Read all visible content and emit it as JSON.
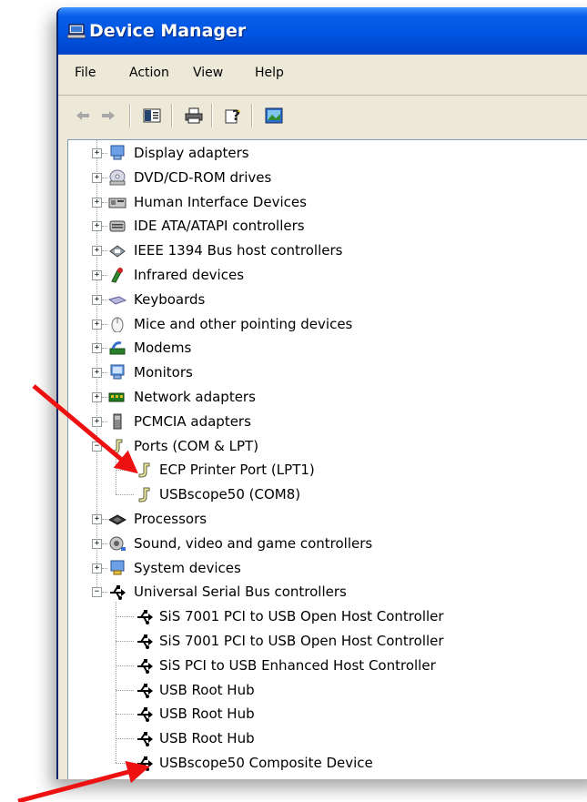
{
  "window": {
    "title": "Device Manager"
  },
  "menu": [
    "File",
    "Action",
    "View",
    "Help"
  ],
  "toolbar": {
    "buttons": [
      "back-icon",
      "forward-icon",
      "show-hide-console-tree-icon",
      "print-icon",
      "help-icon",
      "properties-icon"
    ]
  },
  "tree": [
    {
      "label": "Display adapters",
      "icon": "display-adapter-icon",
      "expanded": false
    },
    {
      "label": "DVD/CD-ROM drives",
      "icon": "cd-drive-icon",
      "expanded": false
    },
    {
      "label": "Human Interface Devices",
      "icon": "hid-icon",
      "expanded": false
    },
    {
      "label": "IDE ATA/ATAPI controllers",
      "icon": "ide-controller-icon",
      "expanded": false
    },
    {
      "label": "IEEE 1394 Bus host controllers",
      "icon": "firewire-icon",
      "expanded": false
    },
    {
      "label": "Infrared devices",
      "icon": "infrared-icon",
      "expanded": false
    },
    {
      "label": "Keyboards",
      "icon": "keyboard-icon",
      "expanded": false
    },
    {
      "label": "Mice and other pointing devices",
      "icon": "mouse-icon",
      "expanded": false
    },
    {
      "label": "Modems",
      "icon": "modem-icon",
      "expanded": false
    },
    {
      "label": "Monitors",
      "icon": "monitor-icon",
      "expanded": false
    },
    {
      "label": "Network adapters",
      "icon": "network-adapter-icon",
      "expanded": false
    },
    {
      "label": "PCMCIA adapters",
      "icon": "pcmcia-icon",
      "expanded": false
    },
    {
      "label": "Ports (COM & LPT)",
      "icon": "port-icon",
      "expanded": true,
      "children": [
        {
          "label": "ECP Printer Port (LPT1)",
          "icon": "port-icon"
        },
        {
          "label": "USBscope50 (COM8)",
          "icon": "port-icon"
        }
      ]
    },
    {
      "label": "Processors",
      "icon": "processor-icon",
      "expanded": false
    },
    {
      "label": "Sound, video and game controllers",
      "icon": "sound-icon",
      "expanded": false
    },
    {
      "label": "System devices",
      "icon": "system-device-icon",
      "expanded": false
    },
    {
      "label": "Universal Serial Bus controllers",
      "icon": "usb-icon",
      "expanded": true,
      "children": [
        {
          "label": "SiS 7001 PCI to USB Open Host Controller",
          "icon": "usb-icon"
        },
        {
          "label": "SiS 7001 PCI to USB Open Host Controller",
          "icon": "usb-icon"
        },
        {
          "label": "SiS PCI to USB Enhanced Host Controller",
          "icon": "usb-icon"
        },
        {
          "label": "USB Root Hub",
          "icon": "usb-icon"
        },
        {
          "label": "USB Root Hub",
          "icon": "usb-icon"
        },
        {
          "label": "USB Root Hub",
          "icon": "usb-icon"
        },
        {
          "label": "USBscope50 Composite Device",
          "icon": "usb-icon"
        }
      ]
    }
  ],
  "annotations": [
    {
      "name": "red-arrow-to-usbscope-com8",
      "color": "#ee1111"
    },
    {
      "name": "red-arrow-to-usbscope-composite",
      "color": "#ee1111"
    }
  ]
}
